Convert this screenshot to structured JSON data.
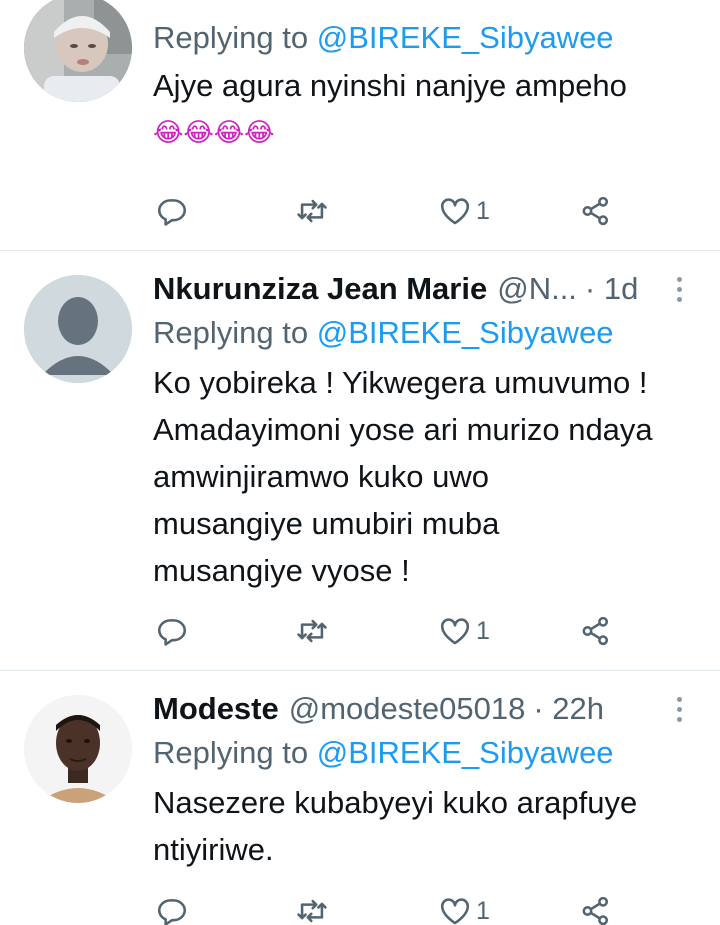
{
  "replies": [
    {
      "replying_prefix": "Replying to",
      "replying_handle": "@BIREKE_Sibyawee",
      "text": "Ajye agura nyinshi nanjye ampeho",
      "emoji": "😂😂😂😂",
      "reply_count": "",
      "retweet_count": "",
      "like_count": "1"
    },
    {
      "name": "Nkurunziza Jean Marie",
      "handle": "@N...",
      "time": "· 1d",
      "replying_prefix": "Replying to",
      "replying_handle": "@BIREKE_Sibyawee",
      "text_lines": [
        "Ko yobireka ! Yikwegera umuvumo !",
        "Amadayimoni yose ari murizo ndaya",
        "amwinjiramwo kuko uwo",
        "musangiye umubiri muba",
        "musangiye vyose !"
      ],
      "like_count": "1"
    },
    {
      "name": "Modeste",
      "handle": "@modeste05018",
      "time": "· 22h",
      "replying_prefix": "Replying to",
      "replying_handle": "@BIREKE_Sibyawee",
      "text_lines": [
        "Nasezere kubabyeyi kuko arapfuye",
        "ntiyiriwe."
      ],
      "like_count": "1"
    }
  ],
  "icons": {
    "reply": "reply-bubble-icon",
    "retweet": "retweet-icon",
    "like": "heart-icon",
    "share": "share-icon",
    "more": "more-vertical-icon"
  },
  "colors": {
    "link": "#1d9bf0",
    "secondary": "#536471",
    "text": "#0f1419",
    "divider": "#e1e8ed"
  }
}
